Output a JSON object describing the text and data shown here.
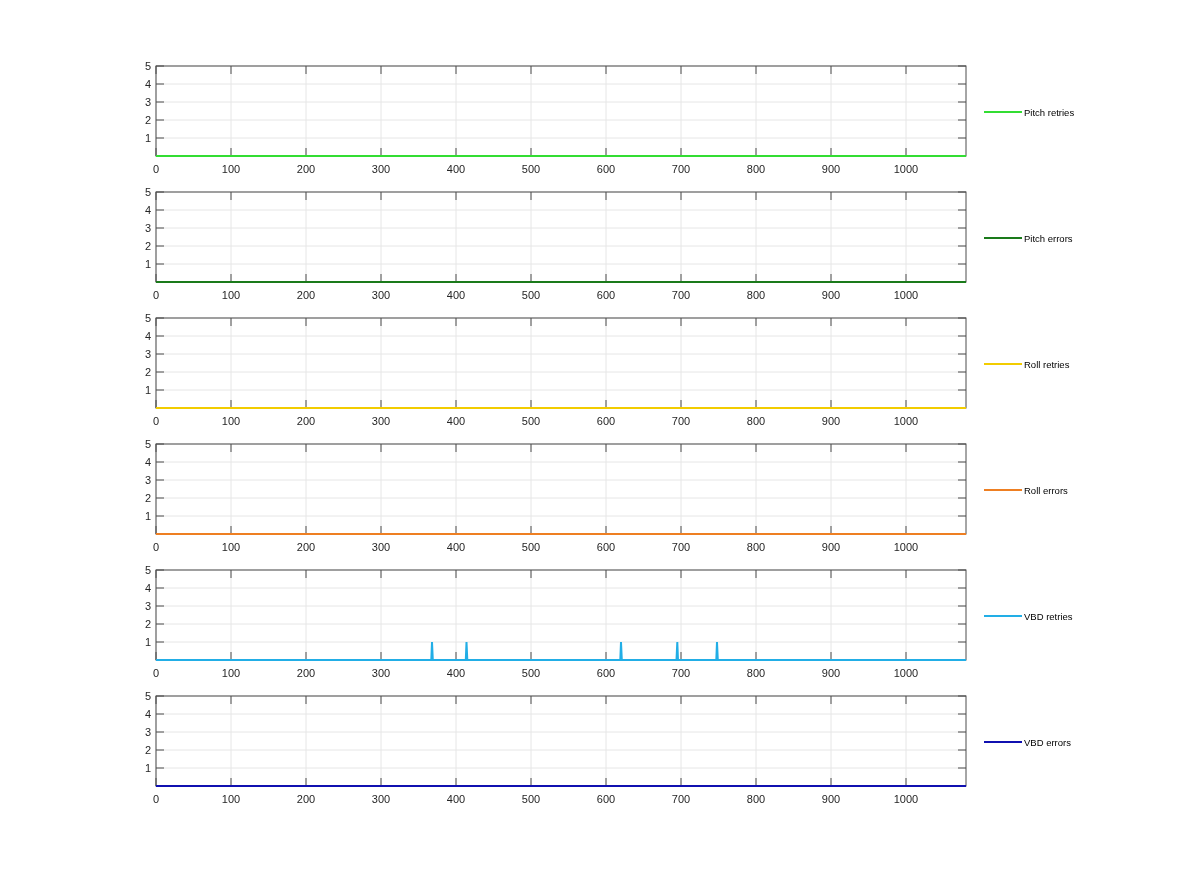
{
  "charts": [
    {
      "chart_data": {
        "type": "line",
        "grid": true,
        "x": [
          0,
          1080
        ],
        "xlim": [
          0,
          1080
        ],
        "ylim": [
          0,
          5
        ],
        "xticks": [
          0,
          100,
          200,
          300,
          400,
          500,
          600,
          700,
          800,
          900,
          1000
        ],
        "yticks": [
          1,
          2,
          3,
          4,
          5
        ],
        "series": [
          {
            "name": "Pitch retries",
            "color": "#33dd33",
            "values": [
              0,
              0
            ]
          }
        ]
      }
    },
    {
      "chart_data": {
        "type": "line",
        "grid": true,
        "x": [
          0,
          1080
        ],
        "xlim": [
          0,
          1080
        ],
        "ylim": [
          0,
          5
        ],
        "xticks": [
          0,
          100,
          200,
          300,
          400,
          500,
          600,
          700,
          800,
          900,
          1000
        ],
        "yticks": [
          1,
          2,
          3,
          4,
          5
        ],
        "series": [
          {
            "name": "Pitch errors",
            "color": "#1a7a1a",
            "values": [
              0,
              0
            ]
          }
        ]
      }
    },
    {
      "chart_data": {
        "type": "line",
        "grid": true,
        "x": [
          0,
          1080
        ],
        "xlim": [
          0,
          1080
        ],
        "ylim": [
          0,
          5
        ],
        "xticks": [
          0,
          100,
          200,
          300,
          400,
          500,
          600,
          700,
          800,
          900,
          1000
        ],
        "yticks": [
          1,
          2,
          3,
          4,
          5
        ],
        "series": [
          {
            "name": "Roll retries",
            "color": "#f2cc00",
            "values": [
              0,
              0
            ]
          }
        ]
      }
    },
    {
      "chart_data": {
        "type": "line",
        "grid": true,
        "x": [
          0,
          1080
        ],
        "xlim": [
          0,
          1080
        ],
        "ylim": [
          0,
          5
        ],
        "xticks": [
          0,
          100,
          200,
          300,
          400,
          500,
          600,
          700,
          800,
          900,
          1000
        ],
        "yticks": [
          1,
          2,
          3,
          4,
          5
        ],
        "series": [
          {
            "name": "Roll errors",
            "color": "#ee7f22",
            "values": [
              0,
              0
            ]
          }
        ]
      }
    },
    {
      "chart_data": {
        "type": "line",
        "grid": true,
        "x": [
          0,
          367,
          368,
          369,
          413,
          414,
          415,
          619,
          620,
          621,
          694,
          695,
          696,
          747,
          748,
          749,
          1080
        ],
        "xlim": [
          0,
          1080
        ],
        "ylim": [
          0,
          5
        ],
        "xticks": [
          0,
          100,
          200,
          300,
          400,
          500,
          600,
          700,
          800,
          900,
          1000
        ],
        "yticks": [
          1,
          2,
          3,
          4,
          5
        ],
        "series": [
          {
            "name": "VBD retries",
            "color": "#22aee6",
            "values": [
              0,
              0,
              1,
              0,
              0,
              1,
              0,
              0,
              1,
              0,
              0,
              1,
              0,
              0,
              1,
              0,
              0
            ]
          }
        ]
      }
    },
    {
      "chart_data": {
        "type": "line",
        "grid": true,
        "x": [
          0,
          1080
        ],
        "xlim": [
          0,
          1080
        ],
        "ylim": [
          0,
          5
        ],
        "xticks": [
          0,
          100,
          200,
          300,
          400,
          500,
          600,
          700,
          800,
          900,
          1000
        ],
        "yticks": [
          1,
          2,
          3,
          4,
          5
        ],
        "series": [
          {
            "name": "VBD errors",
            "color": "#1010b0",
            "values": [
              0,
              0
            ]
          }
        ]
      }
    }
  ]
}
